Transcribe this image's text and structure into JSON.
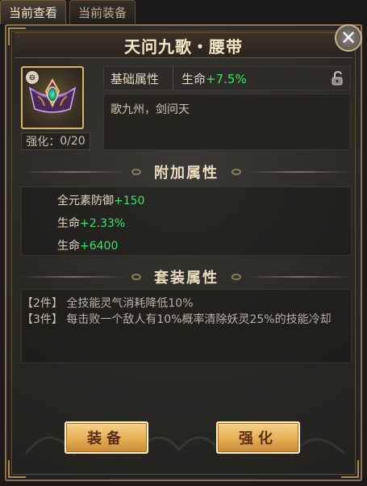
{
  "tabs": {
    "current_view": "当前查看",
    "current_equip": "当前装备"
  },
  "panel": {
    "title": "天问九歌・腰带",
    "close_glyph": "✕"
  },
  "item": {
    "enhance_label": "强化：",
    "enhance_value": "0/20",
    "base_attr_label": "基础属性",
    "base_attr_stat": "生命",
    "base_attr_bonus": "+7.5%",
    "description": "歌九州，剑问天"
  },
  "extra_attrs": {
    "title": "附加属性",
    "items": [
      {
        "stat": "全元素防御",
        "bonus": "+150"
      },
      {
        "stat": "生命",
        "bonus": "+2.33%"
      },
      {
        "stat": "生命",
        "bonus": "+6400"
      }
    ]
  },
  "set_attrs": {
    "title": "套装属性",
    "items": [
      {
        "pieces": "【2件】",
        "effect": "全技能灵气消耗降低10%"
      },
      {
        "pieces": "【3件】",
        "effect": "每击败一个敌人有10%概率清除妖灵25%的技能冷却"
      }
    ]
  },
  "buttons": {
    "equip": "装备",
    "enhance": "强化"
  },
  "colors": {
    "accent_gold": "#d8b36a",
    "bonus_green": "#3fe26a",
    "button_gold": "#e6ad53"
  },
  "icons": {
    "item": "belt-icon",
    "lock": "lock-icon",
    "close": "close-icon"
  }
}
